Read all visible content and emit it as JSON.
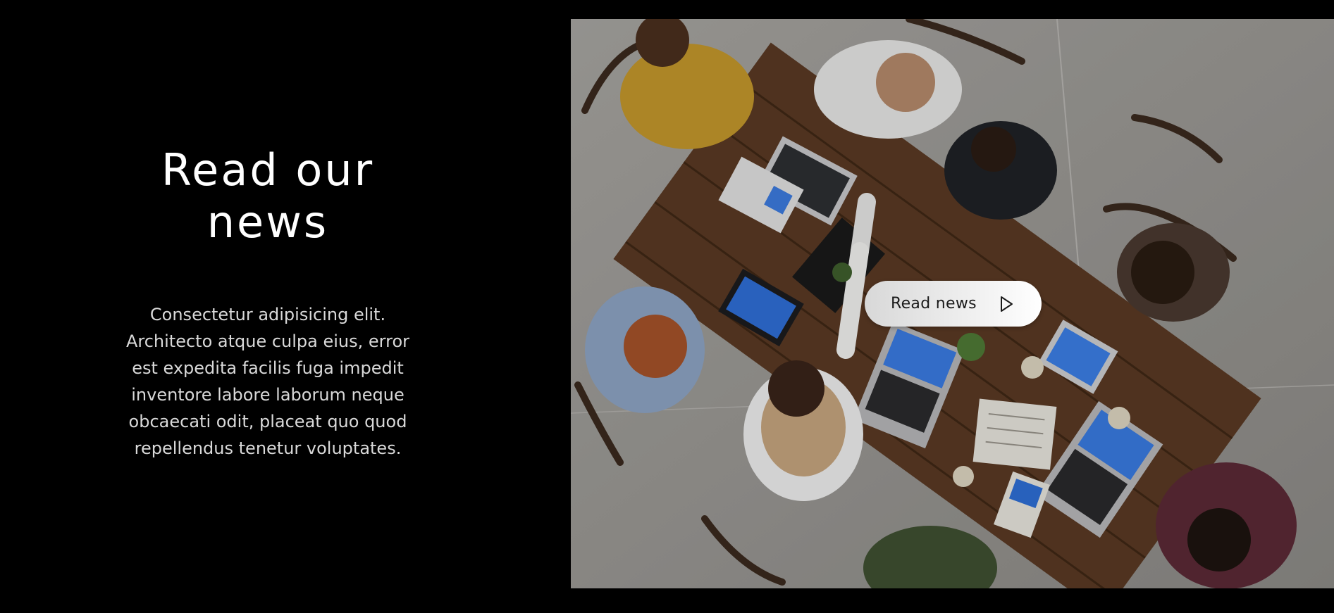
{
  "section": {
    "heading_line1": "Read our",
    "heading_line2": "news",
    "description": "Consectetur adipisicing elit. Architecto atque culpa eius, error est expedita facilis fuga impedit inventore labore laborum neque obcaecati odit, placeat quo quod repellendus tenetur voluptates."
  },
  "photo": {
    "icon": "team-meeting-photo"
  },
  "cta": {
    "label": "Read news",
    "icon": "play-icon"
  },
  "colors": {
    "background": "#000000",
    "heading": "#ffffff",
    "body_text": "#d9d9d9",
    "button_start": "#d8d8d8",
    "button_end": "#ffffff",
    "button_text": "#1a1a1a"
  }
}
